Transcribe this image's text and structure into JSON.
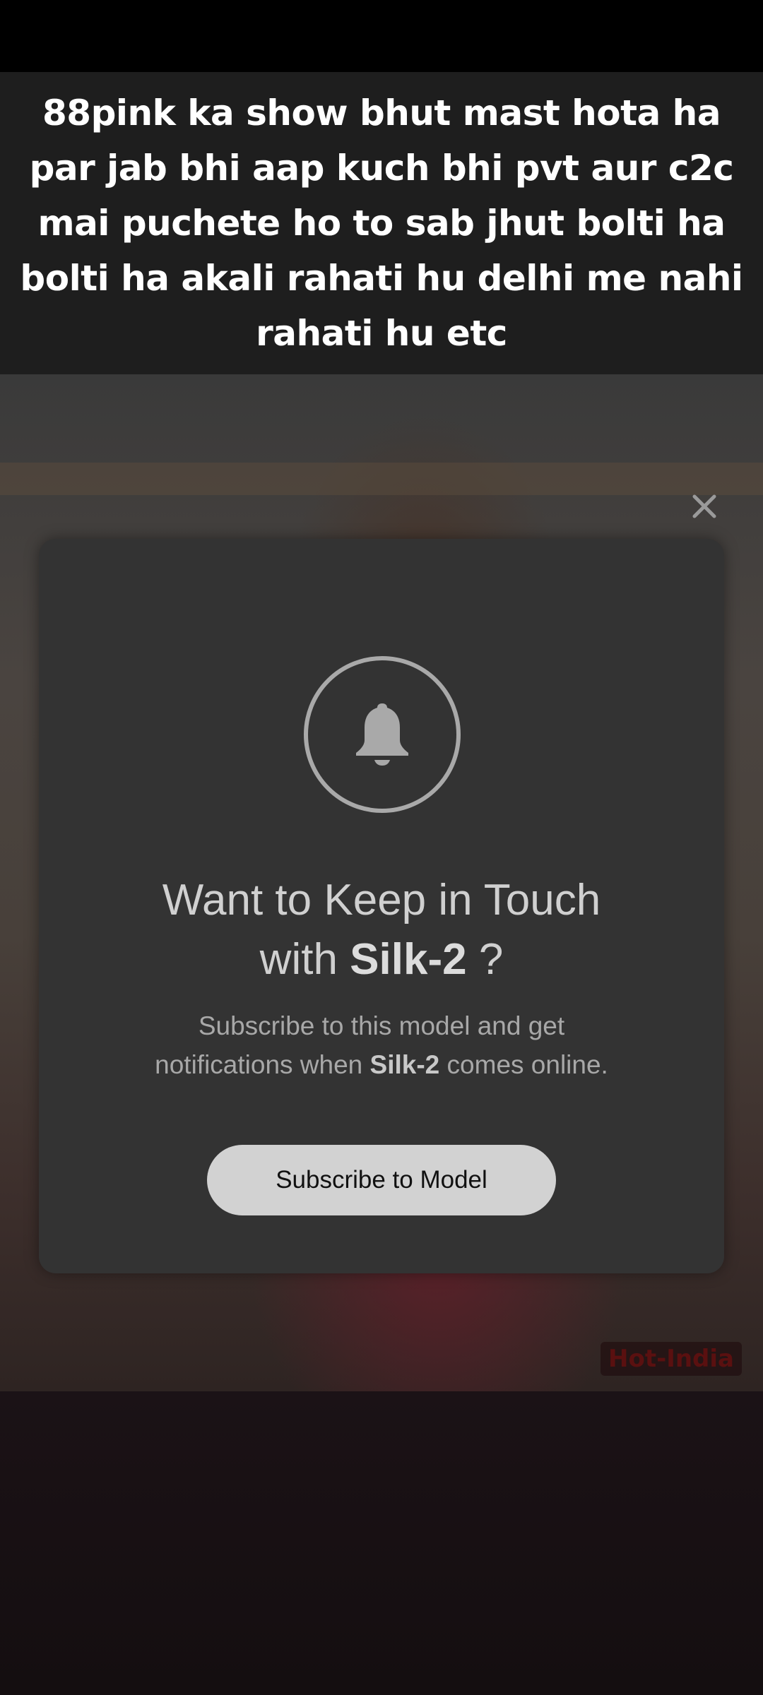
{
  "caption": {
    "text": "88pink ka show bhut mast hota ha par jab bhi aap kuch bhi pvt aur c2c mai puchete ho to sab jhut bolti ha bolti ha akali rahati hu delhi me nahi rahati hu etc"
  },
  "video": {
    "watermark": "Hot-India"
  },
  "modal": {
    "icon": "bell-icon",
    "close_icon": "close-icon",
    "title_prefix": "Want to Keep in Touch",
    "title_with": "with",
    "model_name": "Silk-2",
    "title_suffix": "?",
    "desc_prefix": "Subscribe to this model and get",
    "desc_middle": "notifications when",
    "desc_suffix": "comes online.",
    "button_label": "Subscribe to Model"
  },
  "colors": {
    "modal_bg": "#333333",
    "button_bg": "#d2d2d2",
    "caption_bg": "#1e1e1e"
  }
}
